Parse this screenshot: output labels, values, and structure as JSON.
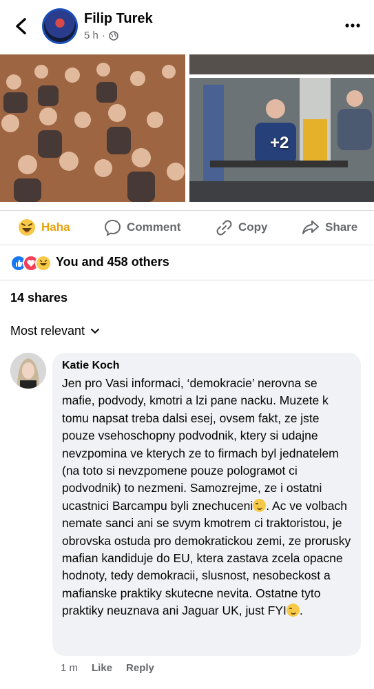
{
  "post": {
    "author": "Filip Turek",
    "time": "5 h",
    "separator": "·",
    "extra_photos": "+2"
  },
  "actions": {
    "reaction": "Haha",
    "comment": "Comment",
    "copy": "Copy",
    "share": "Share"
  },
  "reactions": {
    "summary": "You and 458 others"
  },
  "shares": "14 shares",
  "sort": {
    "label": "Most relevant"
  },
  "comment": {
    "author": "Katie Koch",
    "text_1": "Jen pro Vasi informaci, ‘demokracie’ nerovna se mafie, podvody, kmotri a lzi pane nacku. Muzete k tomu napsat treba dalsi esej, ovsem fakt, ze jste pouze vsehoschopny podvodnik, ktery si udajne nevzpomina ve kterych ze to firmach byl jednatelem (na toto si nevzpomene pouze polograмot ci podvodnik) to nezmeni. Samozrejme, ze i ostatni ucastnici Barcampu byli znechuceni",
    "text_2": ". Ac ve volbach nemate sanci ani se svym kmotrem  ci traktoristou, je obrovska ostuda pro demokratickou zemi, ze prorusky mafian kandiduje do EU, ktera zastava zcela opacne hodnoty, tedy demokracii, slusnost, nesobeckost a mafianske praktiky skutecne nevita. Ostatne tyto praktiky neuznava ani Jaguar UK, just FYI",
    "text_3": ".",
    "time": "1 m",
    "like": "Like",
    "reply": "Reply"
  },
  "colors": {
    "accent_haha": "#f7b928",
    "secondary_text": "#65676b",
    "bubble": "#f0f2f5",
    "like_blue": "#1877f2",
    "love_red": "#f33e58"
  }
}
